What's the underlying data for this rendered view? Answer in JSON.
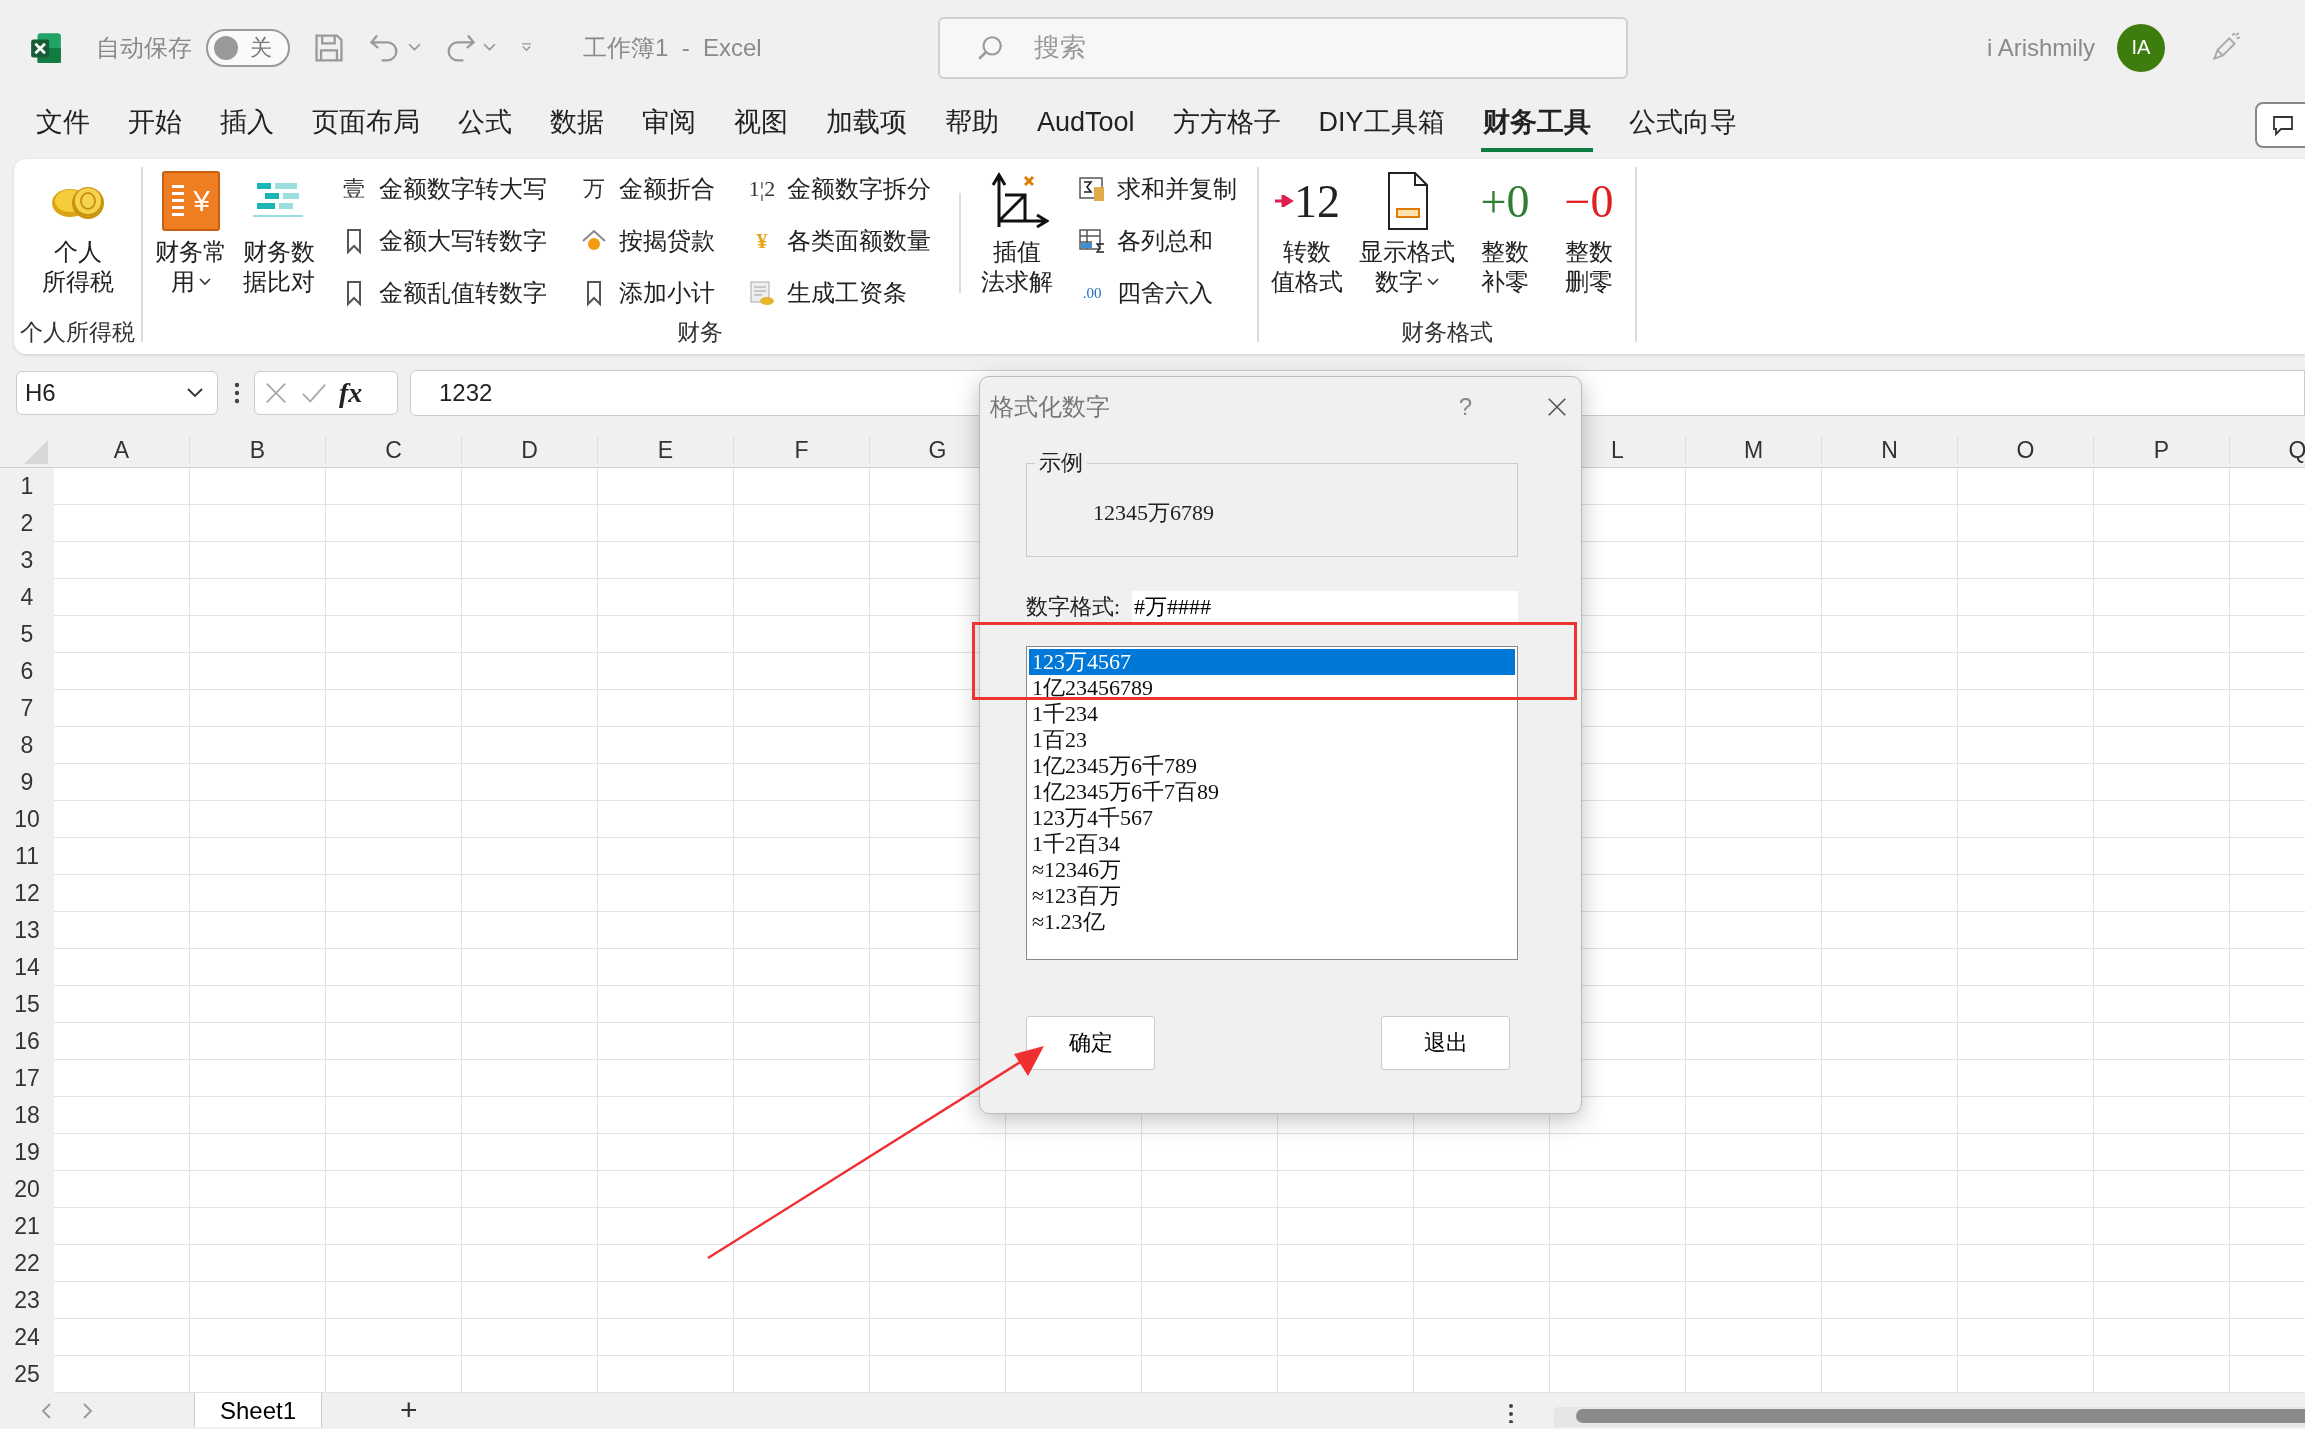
{
  "title_bar": {
    "autosave_label": "自动保存",
    "autosave_toggle": {
      "on": false,
      "label": "关"
    },
    "document_title": "工作簿1  -  Excel",
    "search": {
      "placeholder": "搜索"
    },
    "user_name": "i Arishmily",
    "avatar_initials": "IA"
  },
  "menu_tabs": [
    {
      "label": "文件",
      "selected": false
    },
    {
      "label": "开始",
      "selected": false
    },
    {
      "label": "插入",
      "selected": false
    },
    {
      "label": "页面布局",
      "selected": false
    },
    {
      "label": "公式",
      "selected": false
    },
    {
      "label": "数据",
      "selected": false
    },
    {
      "label": "审阅",
      "selected": false
    },
    {
      "label": "视图",
      "selected": false
    },
    {
      "label": "加载项",
      "selected": false
    },
    {
      "label": "帮助",
      "selected": false
    },
    {
      "label": "AudTool",
      "selected": false
    },
    {
      "label": "方方格子",
      "selected": false
    },
    {
      "label": "DIY工具箱",
      "selected": false
    },
    {
      "label": "财务工具",
      "selected": true
    },
    {
      "label": "公式向导",
      "selected": false
    }
  ],
  "ribbon": {
    "groups": [
      {
        "label": "个人所得税",
        "controls": [
          {
            "kind": "large",
            "lines": [
              "个人",
              "所得税"
            ]
          }
        ]
      },
      {
        "label": "财务",
        "controls": [
          {
            "kind": "large",
            "lines": [
              "财务常",
              "用"
            ],
            "dropdown": true,
            "icon_text": "¥"
          },
          {
            "kind": "large",
            "lines": [
              "财务数",
              "据比对"
            ]
          },
          {
            "kind": "stack",
            "items": [
              {
                "label": "金额数字转大写",
                "icon_text": "壹"
              },
              {
                "label": "金额大写转数字"
              },
              {
                "label": "金额乱值转数字"
              }
            ]
          },
          {
            "kind": "stack",
            "items": [
              {
                "label": "金额折合",
                "icon_text": "万"
              },
              {
                "label": "按揭贷款"
              },
              {
                "label": "添加小计"
              }
            ]
          },
          {
            "kind": "stack",
            "items": [
              {
                "label": "金额数字拆分",
                "icon_text": "1¦2"
              },
              {
                "label": "各类面额数量",
                "icon_text": "¥"
              },
              {
                "label": "生成工资条"
              }
            ]
          },
          {
            "kind": "separator"
          },
          {
            "kind": "large",
            "lines": [
              "插值",
              "法求解"
            ]
          },
          {
            "kind": "stack",
            "items": [
              {
                "label": "求和并复制"
              },
              {
                "label": "各列总和"
              },
              {
                "label": "四舍六入",
                "icon_text": ".00"
              }
            ]
          }
        ]
      },
      {
        "label": "财务格式",
        "controls": [
          {
            "kind": "large",
            "lines": [
              "转数",
              "值格式"
            ],
            "icon_text": "12",
            "color": "#222222"
          },
          {
            "kind": "large",
            "lines": [
              "显示格式",
              "数字"
            ],
            "dropdown": true
          },
          {
            "kind": "large",
            "lines": [
              "整数",
              "补零"
            ],
            "icon_text": "+0",
            "color": "#2e7d32"
          },
          {
            "kind": "large",
            "lines": [
              "整数",
              "删零"
            ],
            "icon_text": "−0",
            "color": "#e02020"
          }
        ]
      }
    ]
  },
  "formula_bar": {
    "name_box": "H6",
    "function_label": "fx",
    "value": "1232"
  },
  "column_headers_left": [
    "A",
    "B",
    "C",
    "D",
    "E",
    "F",
    "G"
  ],
  "column_headers_right": [
    "L",
    "M",
    "N",
    "O",
    "P",
    "Q"
  ],
  "row_headers": [
    "1",
    "2",
    "3",
    "4",
    "5",
    "6",
    "7",
    "8",
    "9",
    "10",
    "11",
    "12",
    "13",
    "14",
    "15",
    "16",
    "17",
    "18",
    "19",
    "20",
    "21",
    "22",
    "23",
    "24",
    "25"
  ],
  "dialog": {
    "title": "格式化数字",
    "help": "?",
    "sample_group": {
      "label": "示例",
      "value": "12345万6789"
    },
    "format_field": {
      "label": "数字格式:",
      "value": "#万####"
    },
    "formats": [
      {
        "label": "123万4567",
        "selected": true
      },
      {
        "label": "1亿23456789",
        "selected": false
      },
      {
        "label": "1千234",
        "selected": false
      },
      {
        "label": "1百23",
        "selected": false
      },
      {
        "label": "1亿2345万6千789",
        "selected": false
      },
      {
        "label": "1亿2345万6千7百89",
        "selected": false
      },
      {
        "label": "123万4千567",
        "selected": false
      },
      {
        "label": "1千2百34",
        "selected": false
      },
      {
        "label": "≈12346万",
        "selected": false
      },
      {
        "label": "≈123百万",
        "selected": false
      },
      {
        "label": "≈1.23亿",
        "selected": false
      }
    ],
    "buttons": [
      "确定",
      "退出"
    ]
  },
  "sheet_tabs": [
    {
      "label": "Sheet1",
      "selected": true
    }
  ],
  "add_sheet": "+"
}
